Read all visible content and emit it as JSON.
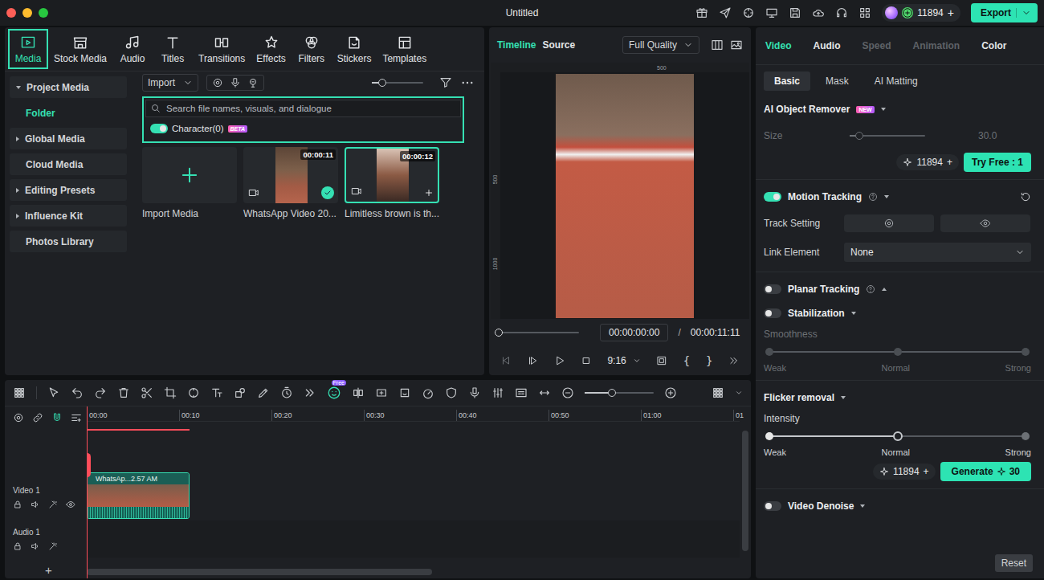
{
  "window": {
    "title": "Untitled"
  },
  "topbar": {
    "credits": "11894",
    "add": "+",
    "export": "Export"
  },
  "media_tabs": [
    {
      "label": "Media",
      "selected": true
    },
    {
      "label": "Stock Media",
      "selected": false
    },
    {
      "label": "Audio",
      "selected": false
    },
    {
      "label": "Titles",
      "selected": false
    },
    {
      "label": "Transitions",
      "selected": false
    },
    {
      "label": "Effects",
      "selected": false
    },
    {
      "label": "Filters",
      "selected": false
    },
    {
      "label": "Stickers",
      "selected": false
    },
    {
      "label": "Templates",
      "selected": false
    }
  ],
  "sidebar": [
    {
      "label": "Project Media",
      "kind": "group",
      "expanded": true,
      "selected": false
    },
    {
      "label": "Folder",
      "kind": "child",
      "expanded": false,
      "selected": true
    },
    {
      "label": "Global Media",
      "kind": "group",
      "expanded": false,
      "selected": false
    },
    {
      "label": "Cloud Media",
      "kind": "item",
      "expanded": false,
      "selected": false
    },
    {
      "label": "Editing Presets",
      "kind": "group",
      "expanded": false,
      "selected": false
    },
    {
      "label": "Influence Kit",
      "kind": "group",
      "expanded": false,
      "selected": false
    },
    {
      "label": "Photos Library",
      "kind": "item",
      "expanded": false,
      "selected": false
    }
  ],
  "media_toolbar": {
    "import": "Import",
    "zoom_level": 0.2
  },
  "search": {
    "placeholder": "Search file names, visuals, and dialogue",
    "toggle": {
      "label": "Character(0)",
      "on": true,
      "badge": "BETA"
    }
  },
  "media_items": [
    {
      "kind": "import",
      "name": "Import Media"
    },
    {
      "kind": "clip",
      "name": "WhatsApp Video 20...",
      "duration": "00:00:11",
      "in_timeline": true,
      "selected": false
    },
    {
      "kind": "clip",
      "name": "Limitless brown is th...",
      "duration": "00:00:12",
      "in_timeline": false,
      "selected": true
    }
  ],
  "preview": {
    "tabs": [
      {
        "label": "Timeline",
        "selected": true
      },
      {
        "label": "Source",
        "selected": false
      }
    ],
    "quality": "Full Quality",
    "ruler_top": [
      "500"
    ],
    "ruler_left": [
      "500",
      "1000"
    ],
    "progress": 0,
    "current": "00:00:00:00",
    "separator": "/",
    "total": "00:00:11:11",
    "ratio": "9:16",
    "mark_in": "{",
    "mark_out": "}"
  },
  "inspector": {
    "tabs": [
      {
        "label": "Video",
        "selected": true,
        "disabled": false
      },
      {
        "label": "Audio",
        "selected": false,
        "disabled": false
      },
      {
        "label": "Speed",
        "selected": false,
        "disabled": true
      },
      {
        "label": "Animation",
        "selected": false,
        "disabled": true
      },
      {
        "label": "Color",
        "selected": false,
        "disabled": false
      }
    ],
    "subtabs": [
      {
        "label": "Basic",
        "selected": true
      },
      {
        "label": "Mask",
        "selected": false
      },
      {
        "label": "AI Matting",
        "selected": false
      }
    ],
    "object_remover": {
      "title": "AI Object Remover",
      "badge": "NEW",
      "expanded": true,
      "size_label": "Size",
      "size_level": 0.13,
      "size_value": "30.0",
      "size_disabled": true,
      "credits": "11894",
      "add": "+",
      "button": "Try Free : 1"
    },
    "motion_tracking": {
      "title": "Motion Tracking",
      "on": true,
      "expanded": true,
      "track_label": "Track Setting",
      "link_label": "Link Element",
      "link_value": "None"
    },
    "planar_tracking": {
      "title": "Planar Tracking",
      "on": false,
      "expanded": false
    },
    "stabilization": {
      "title": "Stabilization",
      "on": false,
      "expanded": true,
      "label": "Smoothness",
      "stops": [
        "Weak",
        "Normal",
        "Strong"
      ],
      "disabled": true
    },
    "flicker": {
      "title": "Flicker removal",
      "expanded": true,
      "label": "Intensity",
      "stops": [
        "Weak",
        "Normal",
        "Strong"
      ],
      "level": 0.5,
      "credits": "11894",
      "add": "+",
      "button": "Generate",
      "cost": "30"
    },
    "denoise": {
      "title": "Video Denoise",
      "on": false,
      "expanded": true
    },
    "reset": "Reset"
  },
  "timeline": {
    "badge": "Free",
    "zoom_level": 0.4,
    "ruler": [
      "00:00",
      "00:10",
      "00:20",
      "00:30",
      "00:40",
      "00:50",
      "01:00",
      "01"
    ],
    "playhead": 0,
    "tracks": [
      {
        "name": "Video 1",
        "kind": "video",
        "clip": "WhatsAp...2.57 AM"
      },
      {
        "name": "Audio 1",
        "kind": "audio"
      }
    ],
    "add": "+"
  }
}
